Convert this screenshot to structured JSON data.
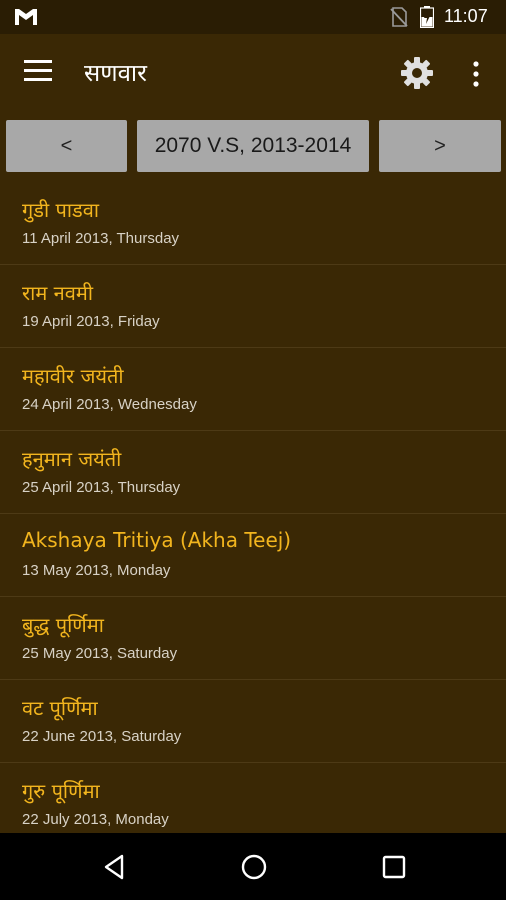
{
  "status_bar": {
    "time": "11:07",
    "icons": [
      "gmail-icon",
      "no-sim-icon",
      "battery-charging-icon"
    ]
  },
  "app_bar": {
    "title": "सणवार",
    "icons": [
      "menu-icon",
      "gear-icon",
      "overflow-menu-icon"
    ]
  },
  "year_nav": {
    "prev_label": "<",
    "year_label": "2070 V.S, 2013-2014",
    "next_label": ">"
  },
  "festivals": [
    {
      "name": "गुडी पाडवा",
      "date": "11 April 2013, Thursday"
    },
    {
      "name": "राम नवमी",
      "date": "19 April 2013, Friday"
    },
    {
      "name": "महावीर जयंती",
      "date": "24 April 2013, Wednesday"
    },
    {
      "name": "हनुमान जयंती",
      "date": "25 April 2013, Thursday"
    },
    {
      "name": "Akshaya Tritiya (Akha Teej)",
      "date": "13 May 2013, Monday"
    },
    {
      "name": "बुद्ध पूर्णिमा",
      "date": "25 May 2013, Saturday"
    },
    {
      "name": "वट पूर्णिमा",
      "date": "22 June 2013, Saturday"
    },
    {
      "name": "गुरु पूर्णिमा",
      "date": "22 July 2013, Monday"
    }
  ],
  "colors": {
    "background": "#3a2805",
    "status_bar": "#2a1d04",
    "festival_text": "#f2b51e",
    "date_text": "#d8d2c6",
    "button": "#a8a8a8"
  },
  "nav_bar": {
    "icons": [
      "back-icon",
      "home-icon",
      "recents-icon"
    ]
  }
}
